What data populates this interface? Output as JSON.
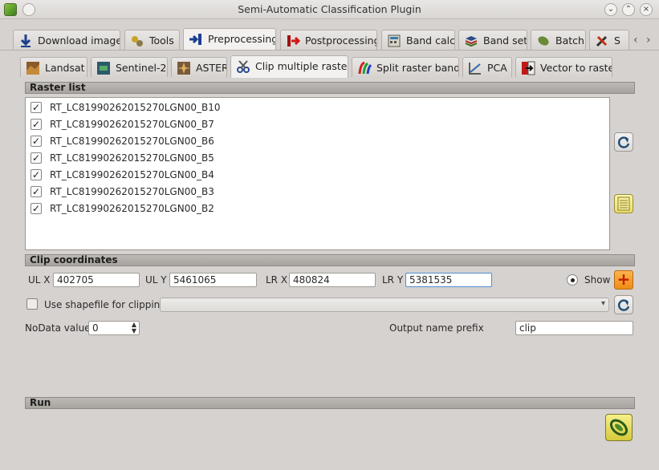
{
  "window": {
    "title": "Semi-Automatic Classification Plugin"
  },
  "main_tabs": [
    {
      "label": "Download images",
      "icon": "download-icon"
    },
    {
      "label": "Tools",
      "icon": "tools-icon"
    },
    {
      "label": "Preprocessing",
      "icon": "preprocessing-icon",
      "active": true
    },
    {
      "label": "Postprocessing",
      "icon": "postprocessing-icon"
    },
    {
      "label": "Band calc",
      "icon": "band-calc-icon"
    },
    {
      "label": "Band set",
      "icon": "band-set-icon"
    },
    {
      "label": "Batch",
      "icon": "batch-icon"
    },
    {
      "label": "S",
      "icon": "settings-icon"
    }
  ],
  "sub_tabs": [
    {
      "label": "Landsat",
      "icon": "landsat-icon"
    },
    {
      "label": "Sentinel-2",
      "icon": "sentinel-icon"
    },
    {
      "label": "ASTER",
      "icon": "aster-icon"
    },
    {
      "label": "Clip multiple rasters",
      "icon": "clip-icon",
      "active": true
    },
    {
      "label": "Split raster bands",
      "icon": "split-icon"
    },
    {
      "label": "PCA",
      "icon": "pca-icon"
    },
    {
      "label": "Vector to raster",
      "icon": "vector-to-raster-icon"
    }
  ],
  "raster_list": {
    "header": "Raster list",
    "items": [
      {
        "name": "RT_LC81990262015270LGN00_B10",
        "checked": true
      },
      {
        "name": "RT_LC81990262015270LGN00_B7",
        "checked": true
      },
      {
        "name": "RT_LC81990262015270LGN00_B6",
        "checked": true
      },
      {
        "name": "RT_LC81990262015270LGN00_B5",
        "checked": true
      },
      {
        "name": "RT_LC81990262015270LGN00_B4",
        "checked": true
      },
      {
        "name": "RT_LC81990262015270LGN00_B3",
        "checked": true
      },
      {
        "name": "RT_LC81990262015270LGN00_B2",
        "checked": true
      }
    ],
    "checkmark": "✓"
  },
  "clip": {
    "header": "Clip coordinates",
    "ulx_label": "UL X",
    "ulx_value": "402705",
    "uly_label": "UL Y",
    "uly_value": "5461065",
    "lrx_label": "LR X",
    "lrx_value": "480824",
    "lry_label": "LR Y",
    "lry_value": "5381535",
    "show_label": "Show",
    "shapefile_label": "Use shapefile for clipping",
    "nodata_label": "NoData value",
    "nodata_value": "0",
    "prefix_label": "Output name prefix",
    "prefix_value": "clip"
  },
  "run": {
    "header": "Run"
  },
  "colors": {
    "accent_orange": "#f08c16",
    "focus_blue": "#4e8fd0",
    "header_gray": "#a8a39e"
  }
}
